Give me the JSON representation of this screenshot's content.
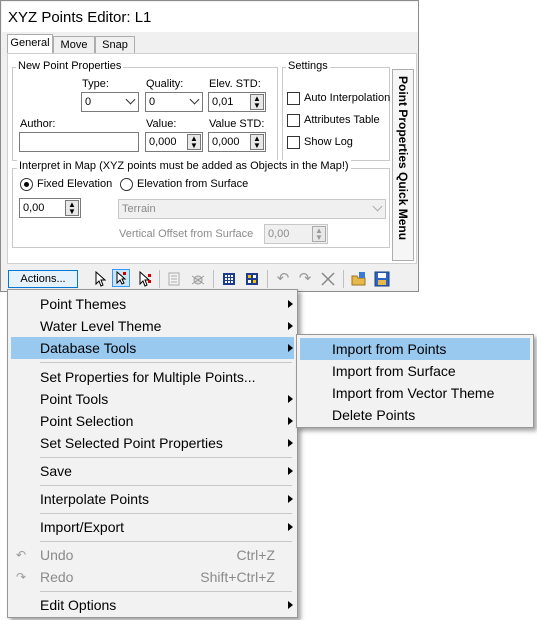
{
  "window": {
    "title": "XYZ Points Editor: L1",
    "tabs": [
      "General",
      "Move",
      "Snap"
    ],
    "vertical_tab": "Point Properties Quick Menu"
  },
  "new_point": {
    "group_label": "New Point Properties",
    "type_label": "Type:",
    "type_value": "0",
    "quality_label": "Quality:",
    "quality_value": "0",
    "elev_std_label": "Elev. STD:",
    "elev_std_value": "0,01",
    "author_label": "Author:",
    "author_value": "",
    "value_label": "Value:",
    "value_value": "0,000",
    "value_std_label": "Value STD:",
    "value_std_value": "0,000"
  },
  "settings": {
    "group_label": "Settings",
    "auto_interpolation": "Auto Interpolation",
    "attributes_table": "Attributes Table",
    "show_log": "Show Log"
  },
  "interpret": {
    "group_label": "Interpret in Map (XYZ points must be added as Objects in the Map!)",
    "fixed_elevation": "Fixed Elevation",
    "elevation_from_surface": "Elevation from Surface",
    "fixed_value": "0,00",
    "surface_value": "Terrain",
    "vertical_offset_label": "Vertical Offset from Surface",
    "vertical_offset_value": "0,00"
  },
  "toolbar": {
    "actions_label": "Actions..."
  },
  "menu": {
    "items": [
      {
        "label": "Point Themes",
        "sub": true
      },
      {
        "label": "Water Level Theme",
        "sub": true
      },
      {
        "label": "Database Tools",
        "sub": true
      },
      {
        "label": "Set Properties for Multiple Points...",
        "sub": false
      },
      {
        "label": "Point Tools",
        "sub": true
      },
      {
        "label": "Point Selection",
        "sub": true
      },
      {
        "label": "Set Selected Point Properties",
        "sub": true
      },
      {
        "label": "Save",
        "sub": true
      },
      {
        "label": "Interpolate Points",
        "sub": true
      },
      {
        "label": "Import/Export",
        "sub": true
      },
      {
        "label": "Undo",
        "shortcut": "Ctrl+Z",
        "disabled": true
      },
      {
        "label": "Redo",
        "shortcut": "Shift+Ctrl+Z",
        "disabled": true
      },
      {
        "label": "Edit Options",
        "sub": true
      }
    ]
  },
  "submenu": {
    "items": [
      "Import from Points",
      "Import from Surface",
      "Import from Vector Theme",
      "Delete Points"
    ]
  },
  "colors": {
    "highlight": "#99c9ef",
    "accent": "#0078d7",
    "menu_bg": "#f2f2f2"
  }
}
